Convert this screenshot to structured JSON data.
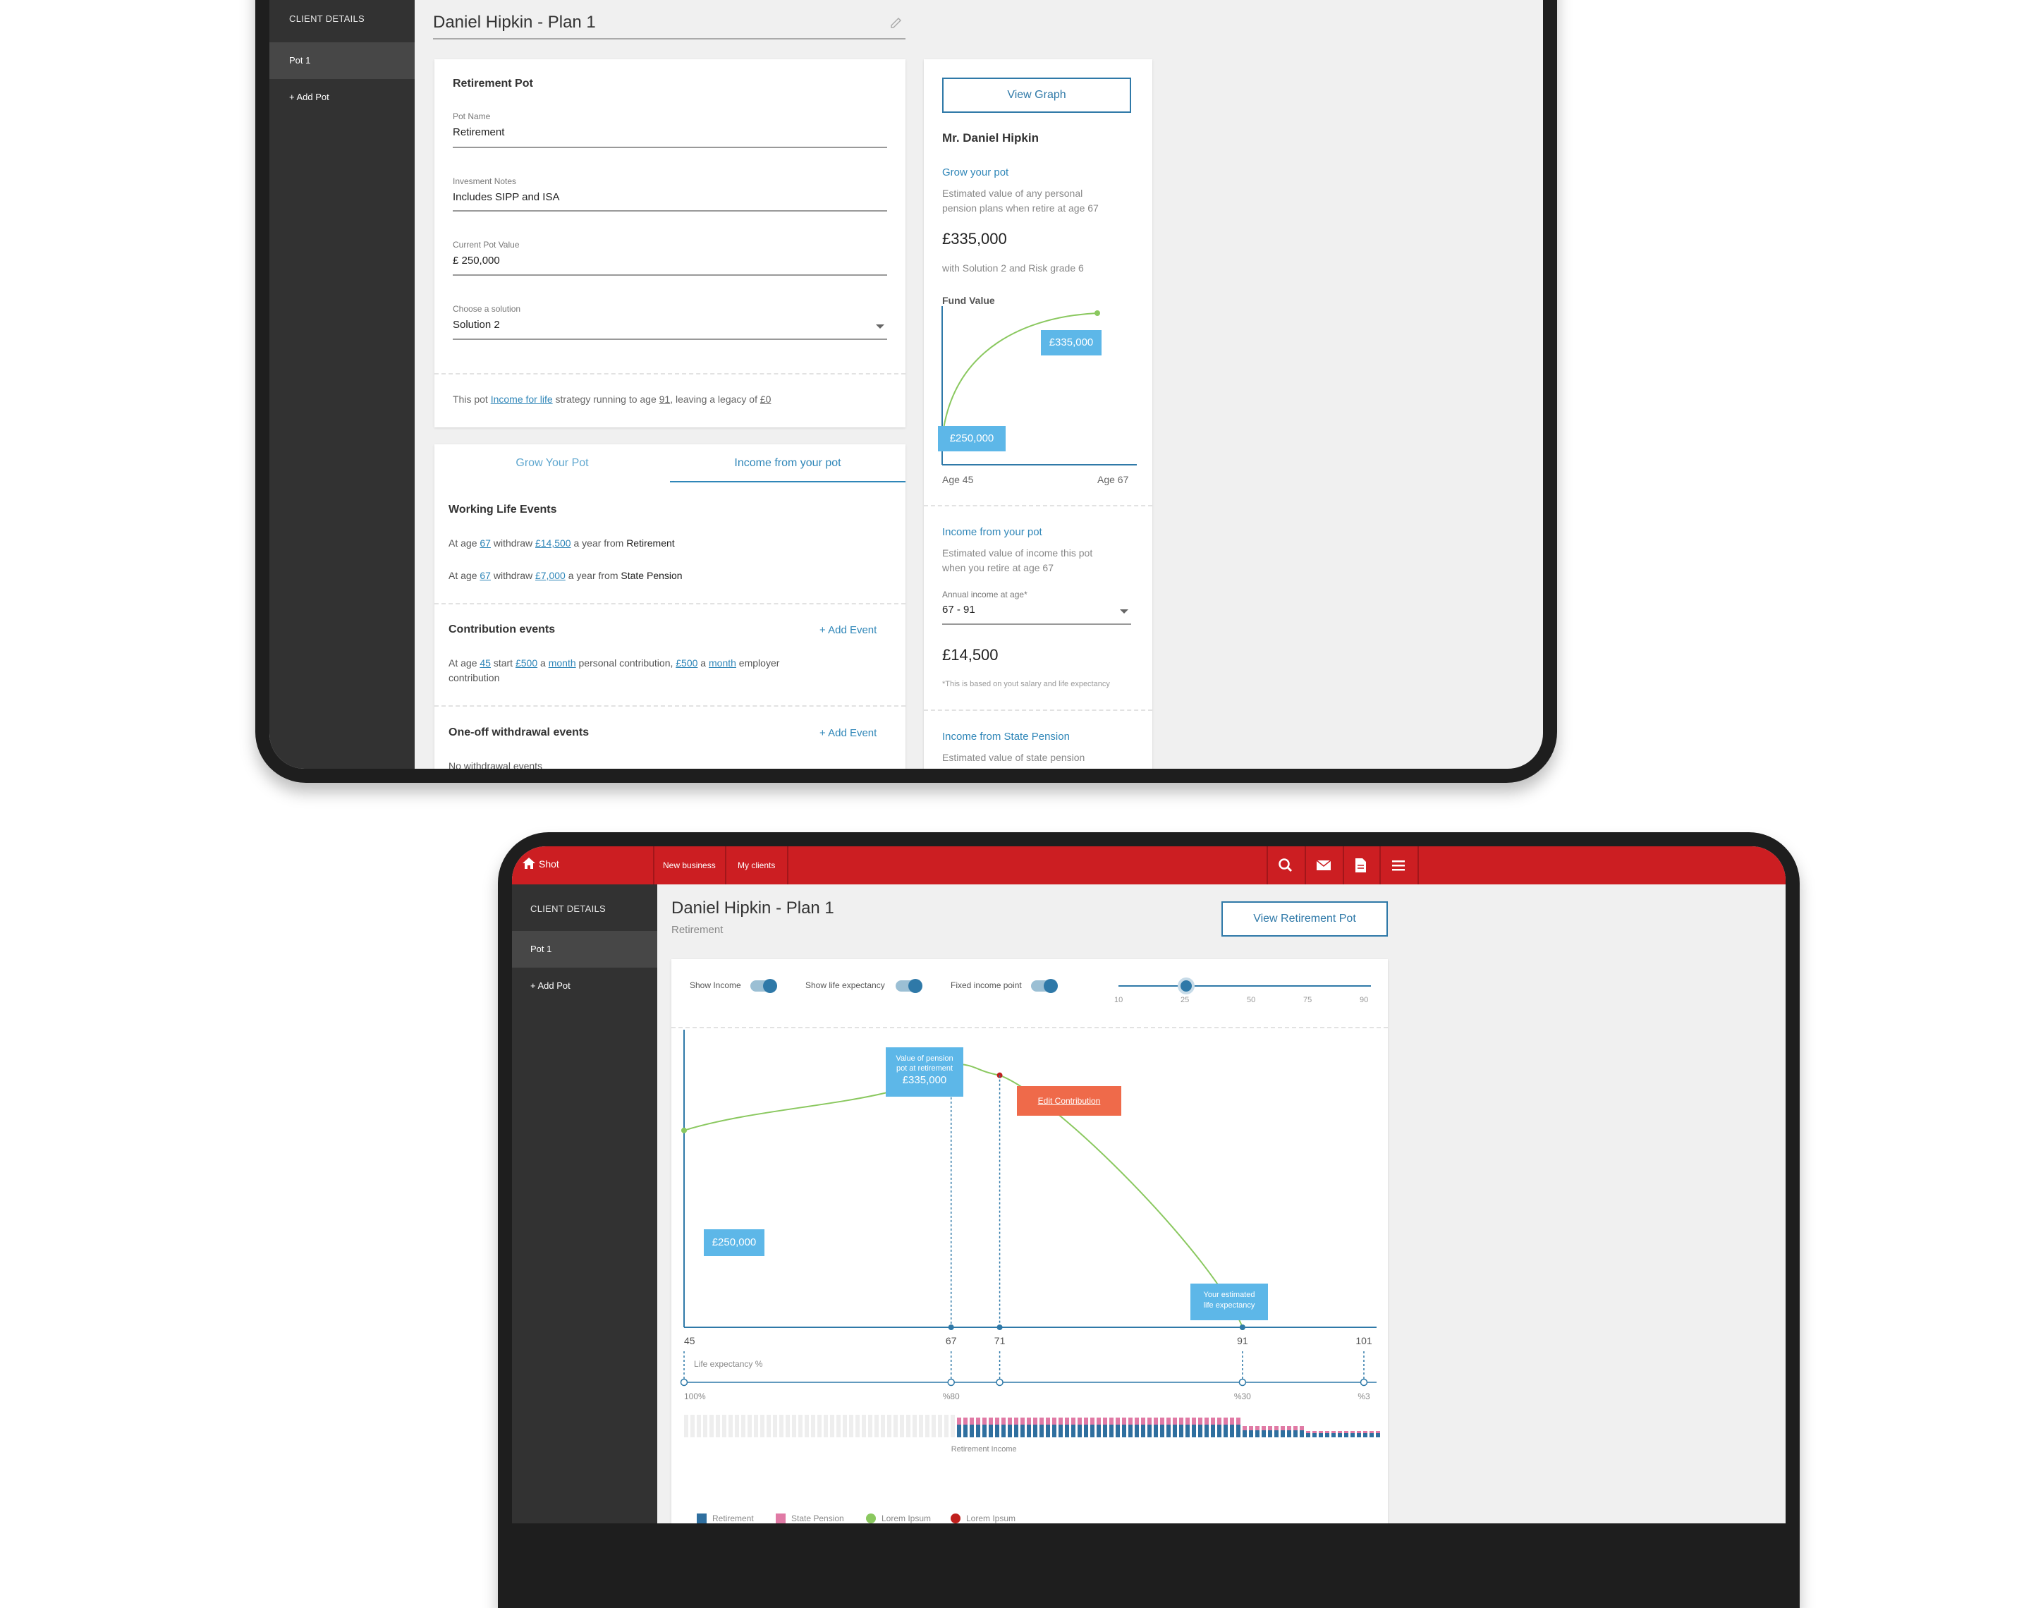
{
  "plan_screen": {
    "sidebar": {
      "header": "CLIENT DETAILS",
      "items": [
        "Pot 1",
        "+ Add Pot"
      ]
    },
    "page_title": "Daniel Hipkin - Plan 1",
    "form": {
      "heading": "Retirement Pot",
      "pot_name_label": "Pot Name",
      "pot_name_value": "Retirement",
      "notes_label": "Invesment Notes",
      "notes_value": "Includes SIPP and ISA",
      "current_label": "Current Pot Value",
      "current_value": "£ 250,000",
      "solution_label": "Choose a solution",
      "solution_value": "Solution 2",
      "summary_prefix": "This pot ",
      "summary_link": "Income for life",
      "summary_mid": " strategy running to age ",
      "summary_age": "91",
      "summary_mid2": ", leaving a legacy of ",
      "summary_legacy": "£0"
    },
    "tabs": [
      "Grow Your Pot",
      "Income from your pot"
    ],
    "working_life": {
      "heading": "Working Life Events",
      "line1": {
        "pre": "At age ",
        "age": "67",
        "mid": " withdraw ",
        "amount": "£14,500",
        "post": " a year from ",
        "source": "Retirement"
      },
      "line2": {
        "pre": "At age ",
        "age": "67",
        "mid": " withdraw ",
        "amount": "£7,000",
        "post": " a year from ",
        "source": "State Pension"
      }
    },
    "contribution": {
      "heading": "Contribution events",
      "add": "+ Add Event",
      "t1": "At age ",
      "age": "45",
      "t2": " start ",
      "amt1": "£500",
      "t3": " a ",
      "per1": "month",
      "t4": " personal contribution, ",
      "amt2": "£500",
      "t5": " a ",
      "per2": "month",
      "t6": " employer",
      "line2": "contribution"
    },
    "oneoff": {
      "heading": "One-off withdrawal events",
      "add": "+ Add Event",
      "cut_text": "No withdrawal events"
    },
    "summary_card": {
      "button": "View Graph",
      "client": "Mr. Daniel Hipkin",
      "grow_title": "Grow your pot",
      "grow_desc1": "Estimated value of any personal",
      "grow_desc2": "pension plans when retire at age 67",
      "value": "£335,000",
      "with_text": "with Solution 2 and Risk grade 6",
      "fund_label": "Fund Value",
      "mini_chart": {
        "start_label": "£250,000",
        "end_label": "£335,000",
        "x_start": "Age 45",
        "x_end": "Age 67"
      },
      "income_title": "Income from your pot",
      "income_desc1": "Estimated value of income this pot",
      "income_desc2": "when you retire at age 67",
      "annual_label": "Annual income at age*",
      "annual_value": "67 - 91",
      "income_value": "£14,500",
      "footnote": "*This is based on yout salary and life expectancy",
      "state_title": "Income from State Pension",
      "state_desc": "Estimated value of state pension"
    }
  },
  "graph_screen": {
    "topbar": {
      "brand": "Shot",
      "nav": [
        "New business",
        "My clients"
      ],
      "icons": [
        "search-icon",
        "mail-icon",
        "document-icon",
        "menu-icon"
      ]
    },
    "sidebar": {
      "header": "CLIENT DETAILS",
      "items": [
        "Pot 1",
        "+ Add Pot"
      ]
    },
    "page_title": "Daniel Hipkin - Plan 1",
    "subtitle": "Retirement",
    "view_button": "View Retirement Pot",
    "toggles": [
      "Show Income",
      "Show life expectancy",
      "Fixed income point"
    ],
    "slider": {
      "ticks": [
        "10",
        "25",
        "50",
        "75",
        "90"
      ],
      "value": 25
    },
    "chart_data": {
      "type": "line",
      "x_ticks": [
        "45",
        "67",
        "71",
        "91",
        "101"
      ],
      "series": [
        {
          "x": [
            45,
            67,
            71,
            91
          ],
          "y": [
            250000,
            335000,
            320000,
            0
          ]
        }
      ],
      "annotations": {
        "start": "£250,000",
        "peak_title_1": "Value of pension",
        "peak_title_2": "pot at retirement",
        "peak_value": "£335,000",
        "edit": "Edit Contribution",
        "life_1": "Your estimated",
        "life_2": "life expectancy"
      },
      "life_label": "Life expectancy %",
      "life_values": [
        "100%",
        "%80",
        "%30",
        "%3"
      ],
      "income_label": "Retirement Income",
      "legend": [
        {
          "label": "Retirement",
          "color": "#2f6f9f"
        },
        {
          "label": "State Pension",
          "color": "#e07aa5"
        },
        {
          "label": "Lorem Ipsum",
          "color": "#8ac85f"
        },
        {
          "label": "Lorem Ipsum",
          "color": "#c0201d"
        }
      ]
    }
  }
}
